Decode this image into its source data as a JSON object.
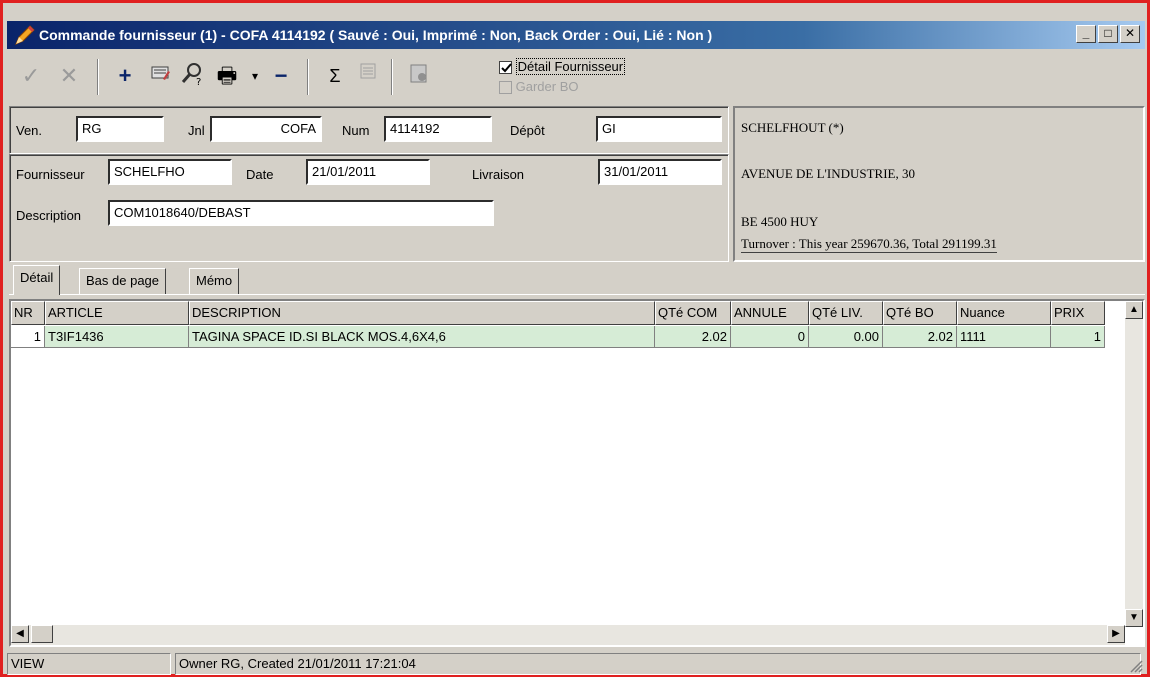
{
  "window": {
    "title": "Commande fournisseur (1) - COFA 4114192 ( Sauvé : Oui, Imprimé : Non, Back Order : Oui, Lié : Non )",
    "minimize": "_",
    "maximize": "□",
    "close": "✕"
  },
  "toolbar": {
    "confirm_icon": "✓",
    "cancel_icon": "✕",
    "add_icon": "+",
    "print_icon": "🖶",
    "remove_icon": "−",
    "sum_icon": "Σ",
    "detail_fournisseur_label": "Détail Fournisseur",
    "garder_bo_label": "Garder BO",
    "detail_fournisseur_checked": true,
    "garder_bo_checked": false
  },
  "header": {
    "ven_label": "Ven.",
    "ven_value": "RG",
    "jnl_label": "Jnl",
    "jnl_value": "COFA",
    "num_label": "Num",
    "num_value": "4114192",
    "depot_label": "Dépôt",
    "depot_value": "GI",
    "fournisseur_label": "Fournisseur",
    "fournisseur_value": "SCHELFHO",
    "date_label": "Date",
    "date_value": "21/01/2011",
    "livraison_label": "Livraison",
    "livraison_value": "31/01/2011",
    "description_label": "Description",
    "description_value": "COM1018640/DEBAST"
  },
  "address": {
    "name": "SCHELFHOUT (*)",
    "street": "AVENUE DE L'INDUSTRIE, 30",
    "city": "BE 4500 HUY",
    "turnover": "Turnover : This year 259670.36, Total 291199.31"
  },
  "tabs": [
    "Détail",
    "Bas de page",
    "Mémo"
  ],
  "grid": {
    "columns": [
      "NR",
      "ARTICLE",
      "DESCRIPTION",
      "QTé COM",
      "ANNULE",
      "QTé LIV.",
      "QTé BO",
      "Nuance",
      "PRIX"
    ],
    "rows": [
      [
        "1",
        "T3IF1436",
        "TAGINA SPACE ID.SI BLACK  MOS.4,6X4,6",
        "2.02",
        "0",
        "0.00",
        "2.02",
        "1111",
        "1"
      ]
    ]
  },
  "statusbar": {
    "mode": "VIEW",
    "info": "Owner RG, Created 21/01/2011 17:21:04"
  },
  "colors": {
    "title_gradient_start": "#0a246a",
    "window_border": "#e02020",
    "row_highlight": "#d6ecd6"
  }
}
